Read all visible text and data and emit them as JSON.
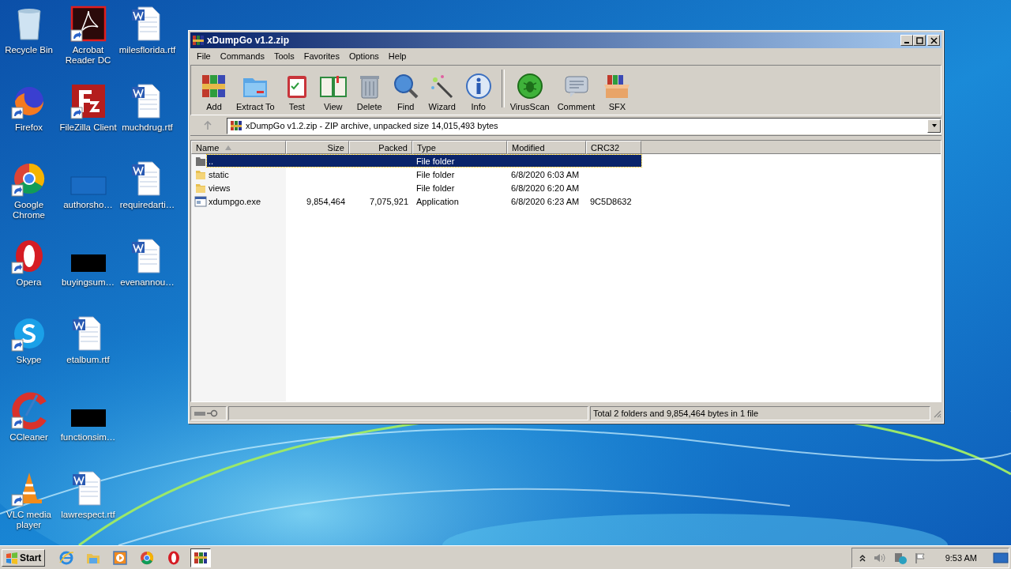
{
  "desktop_icons": [
    {
      "label": "Recycle Bin",
      "kind": "recycle",
      "shortcut": false
    },
    {
      "label": "Firefox",
      "kind": "firefox",
      "shortcut": true
    },
    {
      "label": "Google Chrome",
      "kind": "chrome",
      "shortcut": true
    },
    {
      "label": "Opera",
      "kind": "opera",
      "shortcut": true
    },
    {
      "label": "Skype",
      "kind": "skype",
      "shortcut": true
    },
    {
      "label": "CCleaner",
      "kind": "ccleaner",
      "shortcut": true
    },
    {
      "label": "VLC media player",
      "kind": "vlc",
      "shortcut": true
    },
    {
      "label": "Acrobat Reader DC",
      "kind": "acrobat",
      "shortcut": true
    },
    {
      "label": "FileZilla Client",
      "kind": "filezilla",
      "shortcut": true
    },
    {
      "label": "authorsho…",
      "kind": "blank",
      "shortcut": false
    },
    {
      "label": "buyingsum…",
      "kind": "black",
      "shortcut": false
    },
    {
      "label": "etalbum.rtf",
      "kind": "word",
      "shortcut": false
    },
    {
      "label": "functionsim…",
      "kind": "black",
      "shortcut": false
    },
    {
      "label": "lawrespect.rtf",
      "kind": "word",
      "shortcut": false
    },
    {
      "label": "milesflorida.rtf",
      "kind": "word",
      "shortcut": false
    },
    {
      "label": "muchdrug.rtf",
      "kind": "word",
      "shortcut": false
    },
    {
      "label": "requiredarti…",
      "kind": "word",
      "shortcut": false
    },
    {
      "label": "evenannou…",
      "kind": "word",
      "shortcut": false
    }
  ],
  "window": {
    "title": "xDumpGo v1.2.zip",
    "menu": [
      "File",
      "Commands",
      "Tools",
      "Favorites",
      "Options",
      "Help"
    ],
    "toolbar": [
      {
        "label": "Add",
        "kind": "add"
      },
      {
        "label": "Extract To",
        "kind": "extract"
      },
      {
        "label": "Test",
        "kind": "test"
      },
      {
        "label": "View",
        "kind": "view"
      },
      {
        "label": "Delete",
        "kind": "delete"
      },
      {
        "label": "Find",
        "kind": "find"
      },
      {
        "label": "Wizard",
        "kind": "wizard"
      },
      {
        "label": "Info",
        "kind": "info"
      },
      {
        "label": "VirusScan",
        "kind": "virusscan"
      },
      {
        "label": "Comment",
        "kind": "comment"
      },
      {
        "label": "SFX",
        "kind": "sfx"
      }
    ],
    "address": "xDumpGo v1.2.zip - ZIP archive, unpacked size 14,015,493 bytes",
    "columns": [
      {
        "label": "Name",
        "sorted": true
      },
      {
        "label": "Size",
        "sorted": false
      },
      {
        "label": "Packed",
        "sorted": false
      },
      {
        "label": "Type",
        "sorted": false
      },
      {
        "label": "Modified",
        "sorted": false
      },
      {
        "label": "CRC32",
        "sorted": false
      }
    ],
    "rows": [
      {
        "kind": "parent",
        "name": "..",
        "type": "File folder",
        "selected": true
      },
      {
        "kind": "folder",
        "name": "static",
        "type": "File folder",
        "modified": "6/8/2020 6:03 AM",
        "selected": false
      },
      {
        "kind": "folder",
        "name": "views",
        "type": "File folder",
        "modified": "6/8/2020 6:20 AM",
        "selected": false
      },
      {
        "kind": "exe",
        "name": "xdumpgo.exe",
        "size": "9,854,464",
        "packed": "7,075,921",
        "type": "Application",
        "modified": "6/8/2020 6:23 AM",
        "crc": "9C5D8632",
        "selected": false
      }
    ],
    "status": "Total 2 folders and 9,854,464 bytes in 1 file"
  },
  "taskbar": {
    "start": "Start",
    "apps": [
      {
        "kind": "ie",
        "active": false
      },
      {
        "kind": "explorer",
        "active": false
      },
      {
        "kind": "media",
        "active": false
      },
      {
        "kind": "chrome",
        "active": false
      },
      {
        "kind": "opera",
        "active": false
      },
      {
        "kind": "winrar",
        "active": true
      }
    ],
    "clock": "9:53 AM"
  }
}
